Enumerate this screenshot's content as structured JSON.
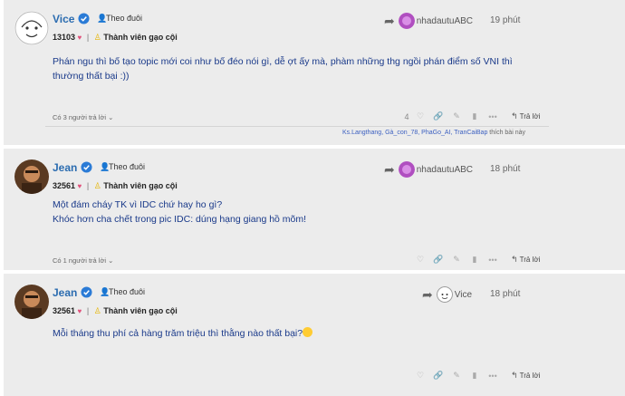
{
  "posts": [
    {
      "author": "Vice",
      "follow_label": "Theo đuôi",
      "score": "13103",
      "rank": "Thành viên gạo cội",
      "reply_to": "nhadautuABC",
      "time": "19 phút",
      "lines": [
        "Phán ngu thì bố tạo topic mới coi như bố đéo nói gì, dễ ợt ấy mà, phàm những thg ngồi phán điểm số VNI thì",
        "thường thất bại :))"
      ],
      "replies_label": "Có 3 người trả lời",
      "like_count": "4",
      "reply_label": "Trả lời",
      "likers": "Ks.Langthang, Gà_con_78, PhaGo_AI, TranCaiBap",
      "likers_suffix": "thích bài này"
    },
    {
      "author": "Jean",
      "follow_label": "Theo đuôi",
      "score": "32561",
      "rank": "Thành viên gạo cội",
      "reply_to": "nhadautuABC",
      "time": "18 phút",
      "lines": [
        "Một đám cháy TK vì IDC chứ hay ho gì?",
        "Khóc hơn cha chết trong pic IDC: dúng hạng giang hồ mõm!"
      ],
      "replies_label": "Có 1 người trả lời",
      "reply_label": "Trả lời"
    },
    {
      "author": "Jean",
      "follow_label": "Theo đuôi",
      "score": "32561",
      "rank": "Thành viên gạo cội",
      "reply_to": "Vice",
      "time": "18 phút",
      "lines": [
        "Mỗi tháng thu phí cả hàng trăm triệu thì thằng nào thất bại?"
      ],
      "reply_label": "Trả lời"
    }
  ],
  "colors": {
    "username": "#2b6cb0",
    "content": "#1a3a8a",
    "background": "#ececec",
    "heart": "#e0507a"
  }
}
